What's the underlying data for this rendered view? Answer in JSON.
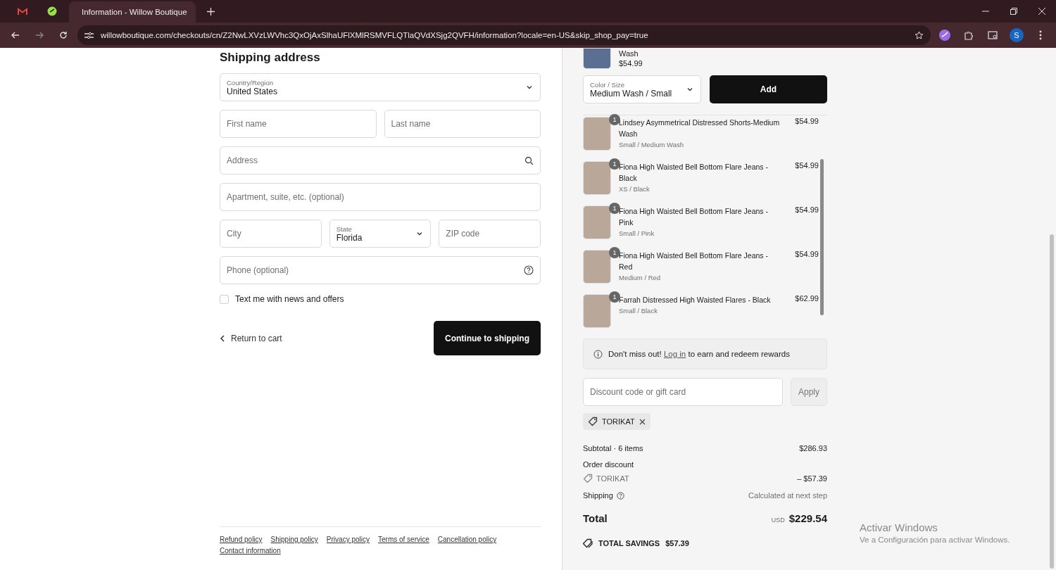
{
  "browser": {
    "tabs": [
      {
        "kind": "mail",
        "selected": false
      },
      {
        "kind": "extension",
        "selected": false
      },
      {
        "kind": "page",
        "title": "Information - Willow Boutique",
        "selected": true
      }
    ],
    "url": "willowboutique.com/checkouts/cn/Z2NwLXVzLWVhc3QxOjAxSlhaUFlXMlRSMVFLQTlaQVdXSjg2QVFH/information?locale=en-US&skip_shop_pay=true",
    "profile_initial": "S"
  },
  "shipping": {
    "heading": "Shipping address",
    "rows": [
      [
        {
          "kind": "select",
          "label": "Country/Region",
          "value": "United States"
        }
      ],
      [
        {
          "kind": "text",
          "placeholder": "First name"
        },
        {
          "kind": "text",
          "placeholder": "Last name"
        }
      ],
      [
        {
          "kind": "search",
          "placeholder": "Address"
        }
      ],
      [
        {
          "kind": "text",
          "placeholder": "Apartment, suite, etc. (optional)"
        }
      ],
      [
        {
          "kind": "text",
          "placeholder": "City"
        },
        {
          "kind": "select",
          "label": "State",
          "value": "Florida"
        },
        {
          "kind": "text",
          "placeholder": "ZIP code"
        }
      ],
      [
        {
          "kind": "help",
          "placeholder": "Phone (optional)"
        }
      ]
    ],
    "sms_opt_in": {
      "label": "Text me with news and offers",
      "checked": false
    },
    "back_link": "Return to cart",
    "continue_button": "Continue to shipping"
  },
  "footer_links": [
    "Refund policy",
    "Shipping policy",
    "Privacy policy",
    "Terms of service",
    "Cancellation policy",
    "Contact information"
  ],
  "upsell": {
    "title": "Wash",
    "price": "$54.99",
    "variant": {
      "label": "Color / Size",
      "value": "Medium Wash / Small"
    },
    "button": "Add"
  },
  "cart_items": [
    {
      "name": "Lindsey Asymmetrical Distressed Shorts-Medium Wash",
      "variant": "Small / Medium Wash",
      "price": "$54.99",
      "quantity": "1"
    },
    {
      "name": "Fiona High Waisted Bell Bottom Flare Jeans - Black",
      "variant": "XS / Black",
      "price": "$54.99",
      "quantity": "1"
    },
    {
      "name": "Fiona High Waisted Bell Bottom Flare Jeans - Pink",
      "variant": "Small / Pink",
      "price": "$54.99",
      "quantity": "1"
    },
    {
      "name": "Fiona High Waisted Bell Bottom Flare Jeans - Red",
      "variant": "Medium / Red",
      "price": "$54.99",
      "quantity": "1"
    },
    {
      "name": "Farrah Distressed High Waisted Flares - Black",
      "variant": "Small / Black",
      "price": "$62.99",
      "quantity": "1"
    }
  ],
  "rewards_notice": {
    "before": "Don't miss out!",
    "link": "Log in",
    "after": "to earn and redeem rewards"
  },
  "discount": {
    "placeholder": "Discount code or gift card",
    "button": "Apply",
    "applied_code": "TORIKAT"
  },
  "summary": {
    "subtotal": {
      "label": "Subtotal · 6 items",
      "value": "$286.93"
    },
    "order_discount": {
      "label": "Order discount",
      "code": "TORIKAT",
      "value": "– $57.39"
    },
    "shipping": {
      "label": "Shipping",
      "value": "Calculated at next step"
    },
    "total": {
      "label": "Total",
      "currency": "USD",
      "value": "$229.54"
    },
    "savings": {
      "label": "TOTAL SAVINGS",
      "value": "$57.39"
    }
  },
  "os_notice": {
    "title": "Activar Windows",
    "subtitle": "Ve a Configuración para activar Windows."
  }
}
